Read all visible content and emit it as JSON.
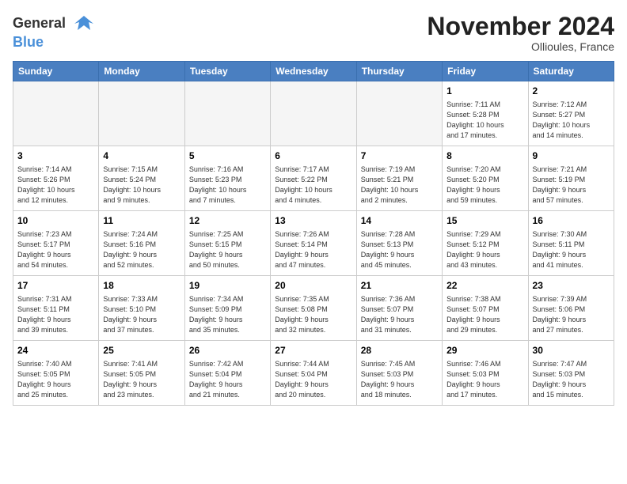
{
  "header": {
    "logo_line1": "General",
    "logo_line2": "Blue",
    "month_title": "November 2024",
    "location": "Ollioules, France"
  },
  "weekdays": [
    "Sunday",
    "Monday",
    "Tuesday",
    "Wednesday",
    "Thursday",
    "Friday",
    "Saturday"
  ],
  "weeks": [
    {
      "days": [
        {
          "num": "",
          "info": ""
        },
        {
          "num": "",
          "info": ""
        },
        {
          "num": "",
          "info": ""
        },
        {
          "num": "",
          "info": ""
        },
        {
          "num": "",
          "info": ""
        },
        {
          "num": "1",
          "info": "Sunrise: 7:11 AM\nSunset: 5:28 PM\nDaylight: 10 hours\nand 17 minutes."
        },
        {
          "num": "2",
          "info": "Sunrise: 7:12 AM\nSunset: 5:27 PM\nDaylight: 10 hours\nand 14 minutes."
        }
      ]
    },
    {
      "days": [
        {
          "num": "3",
          "info": "Sunrise: 7:14 AM\nSunset: 5:26 PM\nDaylight: 10 hours\nand 12 minutes."
        },
        {
          "num": "4",
          "info": "Sunrise: 7:15 AM\nSunset: 5:24 PM\nDaylight: 10 hours\nand 9 minutes."
        },
        {
          "num": "5",
          "info": "Sunrise: 7:16 AM\nSunset: 5:23 PM\nDaylight: 10 hours\nand 7 minutes."
        },
        {
          "num": "6",
          "info": "Sunrise: 7:17 AM\nSunset: 5:22 PM\nDaylight: 10 hours\nand 4 minutes."
        },
        {
          "num": "7",
          "info": "Sunrise: 7:19 AM\nSunset: 5:21 PM\nDaylight: 10 hours\nand 2 minutes."
        },
        {
          "num": "8",
          "info": "Sunrise: 7:20 AM\nSunset: 5:20 PM\nDaylight: 9 hours\nand 59 minutes."
        },
        {
          "num": "9",
          "info": "Sunrise: 7:21 AM\nSunset: 5:19 PM\nDaylight: 9 hours\nand 57 minutes."
        }
      ]
    },
    {
      "days": [
        {
          "num": "10",
          "info": "Sunrise: 7:23 AM\nSunset: 5:17 PM\nDaylight: 9 hours\nand 54 minutes."
        },
        {
          "num": "11",
          "info": "Sunrise: 7:24 AM\nSunset: 5:16 PM\nDaylight: 9 hours\nand 52 minutes."
        },
        {
          "num": "12",
          "info": "Sunrise: 7:25 AM\nSunset: 5:15 PM\nDaylight: 9 hours\nand 50 minutes."
        },
        {
          "num": "13",
          "info": "Sunrise: 7:26 AM\nSunset: 5:14 PM\nDaylight: 9 hours\nand 47 minutes."
        },
        {
          "num": "14",
          "info": "Sunrise: 7:28 AM\nSunset: 5:13 PM\nDaylight: 9 hours\nand 45 minutes."
        },
        {
          "num": "15",
          "info": "Sunrise: 7:29 AM\nSunset: 5:12 PM\nDaylight: 9 hours\nand 43 minutes."
        },
        {
          "num": "16",
          "info": "Sunrise: 7:30 AM\nSunset: 5:11 PM\nDaylight: 9 hours\nand 41 minutes."
        }
      ]
    },
    {
      "days": [
        {
          "num": "17",
          "info": "Sunrise: 7:31 AM\nSunset: 5:11 PM\nDaylight: 9 hours\nand 39 minutes."
        },
        {
          "num": "18",
          "info": "Sunrise: 7:33 AM\nSunset: 5:10 PM\nDaylight: 9 hours\nand 37 minutes."
        },
        {
          "num": "19",
          "info": "Sunrise: 7:34 AM\nSunset: 5:09 PM\nDaylight: 9 hours\nand 35 minutes."
        },
        {
          "num": "20",
          "info": "Sunrise: 7:35 AM\nSunset: 5:08 PM\nDaylight: 9 hours\nand 32 minutes."
        },
        {
          "num": "21",
          "info": "Sunrise: 7:36 AM\nSunset: 5:07 PM\nDaylight: 9 hours\nand 31 minutes."
        },
        {
          "num": "22",
          "info": "Sunrise: 7:38 AM\nSunset: 5:07 PM\nDaylight: 9 hours\nand 29 minutes."
        },
        {
          "num": "23",
          "info": "Sunrise: 7:39 AM\nSunset: 5:06 PM\nDaylight: 9 hours\nand 27 minutes."
        }
      ]
    },
    {
      "days": [
        {
          "num": "24",
          "info": "Sunrise: 7:40 AM\nSunset: 5:05 PM\nDaylight: 9 hours\nand 25 minutes."
        },
        {
          "num": "25",
          "info": "Sunrise: 7:41 AM\nSunset: 5:05 PM\nDaylight: 9 hours\nand 23 minutes."
        },
        {
          "num": "26",
          "info": "Sunrise: 7:42 AM\nSunset: 5:04 PM\nDaylight: 9 hours\nand 21 minutes."
        },
        {
          "num": "27",
          "info": "Sunrise: 7:44 AM\nSunset: 5:04 PM\nDaylight: 9 hours\nand 20 minutes."
        },
        {
          "num": "28",
          "info": "Sunrise: 7:45 AM\nSunset: 5:03 PM\nDaylight: 9 hours\nand 18 minutes."
        },
        {
          "num": "29",
          "info": "Sunrise: 7:46 AM\nSunset: 5:03 PM\nDaylight: 9 hours\nand 17 minutes."
        },
        {
          "num": "30",
          "info": "Sunrise: 7:47 AM\nSunset: 5:03 PM\nDaylight: 9 hours\nand 15 minutes."
        }
      ]
    }
  ]
}
